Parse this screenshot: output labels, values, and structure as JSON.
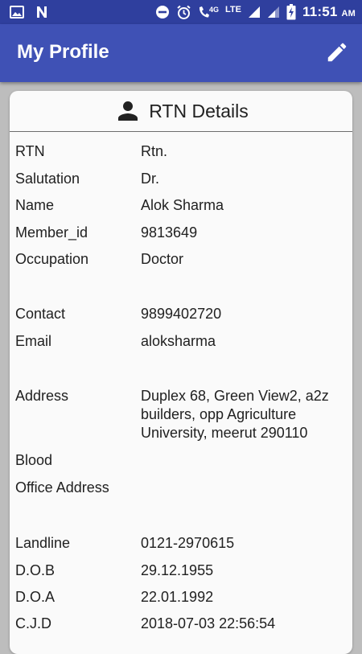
{
  "status_bar": {
    "network": "4G",
    "lte": "LTE",
    "time": "11:51",
    "ampm": "AM"
  },
  "app_bar": {
    "title": "My Profile"
  },
  "card": {
    "title": "RTN Details"
  },
  "rows": [
    {
      "label": "RTN",
      "value": "Rtn."
    },
    {
      "label": "Salutation",
      "value": "Dr."
    },
    {
      "label": "Name",
      "value": "Alok Sharma"
    },
    {
      "label": "Member_id",
      "value": "9813649"
    },
    {
      "label": "Occupation",
      "value": "Doctor"
    },
    {
      "label": "Contact",
      "value": "9899402720"
    },
    {
      "label": "Email",
      "value": "aloksharma"
    },
    {
      "label": "Address",
      "value": "Duplex 68, Green View2, a2z builders, opp Agriculture University, meerut 290110"
    },
    {
      "label": "Blood",
      "value": ""
    },
    {
      "label": "Office Address",
      "value": ""
    },
    {
      "label": "Landline",
      "value": "0121-2970615"
    },
    {
      "label": "D.O.B",
      "value": "29.12.1955"
    },
    {
      "label": "D.O.A",
      "value": "22.01.1992"
    },
    {
      "label": "C.J.D",
      "value": "2018-07-03 22:56:54"
    }
  ]
}
